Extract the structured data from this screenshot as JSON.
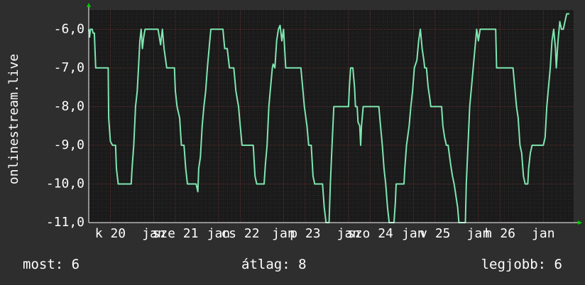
{
  "chart_data": {
    "type": "line",
    "ylabel": "onlinestream.live",
    "ylim": [
      -11,
      -5.5
    ],
    "y_ticks": [
      -6,
      -7,
      -8,
      -9,
      -10,
      -11
    ],
    "y_tick_labels": [
      "-6,0",
      "-7,0",
      "-8,0",
      "-9,0",
      "-10,0",
      "-11,0"
    ],
    "x_ticks": [
      {
        "x": 0.5,
        "label": "k 20"
      },
      {
        "x": 1.5,
        "label": "jan"
      },
      {
        "x": 2.0,
        "label": "sze 21"
      },
      {
        "x": 3.0,
        "label": "jan"
      },
      {
        "x": 3.5,
        "label": "cs 22"
      },
      {
        "x": 4.5,
        "label": "jan"
      },
      {
        "x": 5.0,
        "label": "p 23"
      },
      {
        "x": 6.0,
        "label": "jan"
      },
      {
        "x": 6.5,
        "label": "szo 24"
      },
      {
        "x": 7.5,
        "label": "jan"
      },
      {
        "x": 8.0,
        "label": "v 25"
      },
      {
        "x": 9.0,
        "label": "jan"
      },
      {
        "x": 9.5,
        "label": "h 26"
      },
      {
        "x": 10.5,
        "label": "jan"
      }
    ],
    "xlim": [
      0,
      11.2
    ],
    "grid": true,
    "series": [
      {
        "color": "#7fe5b0",
        "points": [
          [
            0.0,
            -6.0
          ],
          [
            0.02,
            -6.2
          ],
          [
            0.04,
            -6.0
          ],
          [
            0.08,
            -6.0
          ],
          [
            0.1,
            -6.1
          ],
          [
            0.13,
            -6.1
          ],
          [
            0.16,
            -7.0
          ],
          [
            0.45,
            -7.0
          ],
          [
            0.46,
            -8.3
          ],
          [
            0.5,
            -8.9
          ],
          [
            0.55,
            -9.0
          ],
          [
            0.62,
            -9.0
          ],
          [
            0.64,
            -9.6
          ],
          [
            0.68,
            -10.0
          ],
          [
            0.98,
            -10.0
          ],
          [
            1.0,
            -9.6
          ],
          [
            1.04,
            -9.0
          ],
          [
            1.08,
            -8.0
          ],
          [
            1.12,
            -7.6
          ],
          [
            1.15,
            -7.0
          ],
          [
            1.18,
            -6.3
          ],
          [
            1.21,
            -6.0
          ],
          [
            1.24,
            -6.5
          ],
          [
            1.27,
            -6.2
          ],
          [
            1.3,
            -6.0
          ],
          [
            1.6,
            -6.0
          ],
          [
            1.63,
            -6.2
          ],
          [
            1.66,
            -6.4
          ],
          [
            1.7,
            -6.0
          ],
          [
            1.74,
            -6.5
          ],
          [
            1.8,
            -7.0
          ],
          [
            1.98,
            -7.0
          ],
          [
            2.0,
            -7.6
          ],
          [
            2.04,
            -8.0
          ],
          [
            2.1,
            -8.3
          ],
          [
            2.14,
            -9.0
          ],
          [
            2.2,
            -9.0
          ],
          [
            2.24,
            -9.6
          ],
          [
            2.28,
            -10.0
          ],
          [
            2.48,
            -10.0
          ],
          [
            2.52,
            -10.2
          ],
          [
            2.54,
            -9.6
          ],
          [
            2.58,
            -9.3
          ],
          [
            2.62,
            -8.5
          ],
          [
            2.66,
            -8.0
          ],
          [
            2.7,
            -7.6
          ],
          [
            2.74,
            -7.0
          ],
          [
            2.78,
            -6.5
          ],
          [
            2.82,
            -6.0
          ],
          [
            3.1,
            -6.0
          ],
          [
            3.14,
            -6.5
          ],
          [
            3.2,
            -6.5
          ],
          [
            3.25,
            -7.0
          ],
          [
            3.35,
            -7.0
          ],
          [
            3.4,
            -7.6
          ],
          [
            3.46,
            -8.0
          ],
          [
            3.5,
            -8.5
          ],
          [
            3.54,
            -9.0
          ],
          [
            3.8,
            -9.0
          ],
          [
            3.84,
            -9.8
          ],
          [
            3.88,
            -10.0
          ],
          [
            4.05,
            -10.0
          ],
          [
            4.08,
            -9.5
          ],
          [
            4.12,
            -9.0
          ],
          [
            4.16,
            -8.0
          ],
          [
            4.2,
            -7.5
          ],
          [
            4.24,
            -7.0
          ],
          [
            4.26,
            -6.9
          ],
          [
            4.3,
            -7.0
          ],
          [
            4.34,
            -6.3
          ],
          [
            4.38,
            -6.0
          ],
          [
            4.42,
            -5.9
          ],
          [
            4.46,
            -6.3
          ],
          [
            4.5,
            -6.0
          ],
          [
            4.55,
            -7.0
          ],
          [
            4.9,
            -7.0
          ],
          [
            4.94,
            -7.5
          ],
          [
            4.98,
            -8.0
          ],
          [
            5.04,
            -8.5
          ],
          [
            5.08,
            -9.0
          ],
          [
            5.14,
            -9.0
          ],
          [
            5.18,
            -9.8
          ],
          [
            5.22,
            -10.0
          ],
          [
            5.4,
            -10.0
          ],
          [
            5.44,
            -10.6
          ],
          [
            5.48,
            -11.0
          ],
          [
            5.55,
            -11.0
          ],
          [
            5.58,
            -10.0
          ],
          [
            5.62,
            -9.0
          ],
          [
            5.66,
            -8.0
          ],
          [
            6.0,
            -8.0
          ],
          [
            6.02,
            -7.5
          ],
          [
            6.05,
            -7.0
          ],
          [
            6.1,
            -7.0
          ],
          [
            6.14,
            -7.5
          ],
          [
            6.16,
            -8.0
          ],
          [
            6.2,
            -8.0
          ],
          [
            6.22,
            -8.4
          ],
          [
            6.26,
            -8.5
          ],
          [
            6.28,
            -9.0
          ],
          [
            6.3,
            -8.5
          ],
          [
            6.34,
            -8.0
          ],
          [
            6.7,
            -8.0
          ],
          [
            6.74,
            -8.5
          ],
          [
            6.78,
            -9.0
          ],
          [
            6.82,
            -9.6
          ],
          [
            6.86,
            -10.0
          ],
          [
            6.9,
            -10.6
          ],
          [
            6.94,
            -11.0
          ],
          [
            7.05,
            -11.0
          ],
          [
            7.08,
            -10.5
          ],
          [
            7.1,
            -10.0
          ],
          [
            7.28,
            -10.0
          ],
          [
            7.3,
            -9.6
          ],
          [
            7.34,
            -9.0
          ],
          [
            7.4,
            -8.5
          ],
          [
            7.44,
            -8.0
          ],
          [
            7.48,
            -7.6
          ],
          [
            7.52,
            -7.0
          ],
          [
            7.58,
            -6.8
          ],
          [
            7.62,
            -6.3
          ],
          [
            7.66,
            -6.0
          ],
          [
            7.7,
            -6.5
          ],
          [
            7.74,
            -6.8
          ],
          [
            7.76,
            -7.0
          ],
          [
            7.8,
            -7.0
          ],
          [
            7.84,
            -7.5
          ],
          [
            7.88,
            -7.8
          ],
          [
            7.9,
            -8.0
          ],
          [
            8.15,
            -8.0
          ],
          [
            8.18,
            -8.5
          ],
          [
            8.22,
            -8.8
          ],
          [
            8.26,
            -9.0
          ],
          [
            8.3,
            -9.0
          ],
          [
            8.36,
            -9.5
          ],
          [
            8.4,
            -9.8
          ],
          [
            8.44,
            -10.0
          ],
          [
            8.48,
            -10.3
          ],
          [
            8.52,
            -10.6
          ],
          [
            8.55,
            -11.0
          ],
          [
            8.7,
            -11.0
          ],
          [
            8.72,
            -10.0
          ],
          [
            8.76,
            -9.0
          ],
          [
            8.8,
            -8.0
          ],
          [
            8.84,
            -7.5
          ],
          [
            8.88,
            -7.0
          ],
          [
            8.92,
            -6.5
          ],
          [
            8.96,
            -6.0
          ],
          [
            9.0,
            -6.3
          ],
          [
            9.04,
            -6.0
          ],
          [
            9.4,
            -6.0
          ],
          [
            9.42,
            -7.0
          ],
          [
            9.8,
            -7.0
          ],
          [
            9.84,
            -7.5
          ],
          [
            9.88,
            -8.0
          ],
          [
            9.92,
            -8.3
          ],
          [
            9.96,
            -9.0
          ],
          [
            10.0,
            -9.2
          ],
          [
            10.04,
            -9.8
          ],
          [
            10.08,
            -10.0
          ],
          [
            10.14,
            -10.0
          ],
          [
            10.16,
            -9.6
          ],
          [
            10.2,
            -9.2
          ],
          [
            10.24,
            -9.0
          ],
          [
            10.5,
            -9.0
          ],
          [
            10.54,
            -8.8
          ],
          [
            10.58,
            -8.0
          ],
          [
            10.62,
            -7.5
          ],
          [
            10.66,
            -7.0
          ],
          [
            10.7,
            -6.3
          ],
          [
            10.74,
            -6.0
          ],
          [
            10.78,
            -6.5
          ],
          [
            10.8,
            -7.0
          ],
          [
            10.84,
            -6.3
          ],
          [
            10.88,
            -5.8
          ],
          [
            10.92,
            -6.0
          ],
          [
            10.96,
            -6.0
          ],
          [
            11.0,
            -5.8
          ],
          [
            11.04,
            -5.6
          ],
          [
            11.1,
            -5.6
          ]
        ]
      }
    ]
  },
  "stats": {
    "now": "most: 6",
    "avg": "átlag: 8",
    "max": "legjobb: 6"
  },
  "colors": {
    "background": "#2e2e2e",
    "plot_bg": "#1a1a1a",
    "line": "#7fe5b0",
    "axis_arrow": "#00cc00",
    "grid_major": "#5a2a2a",
    "grid_minor": "#3a3a3a"
  }
}
